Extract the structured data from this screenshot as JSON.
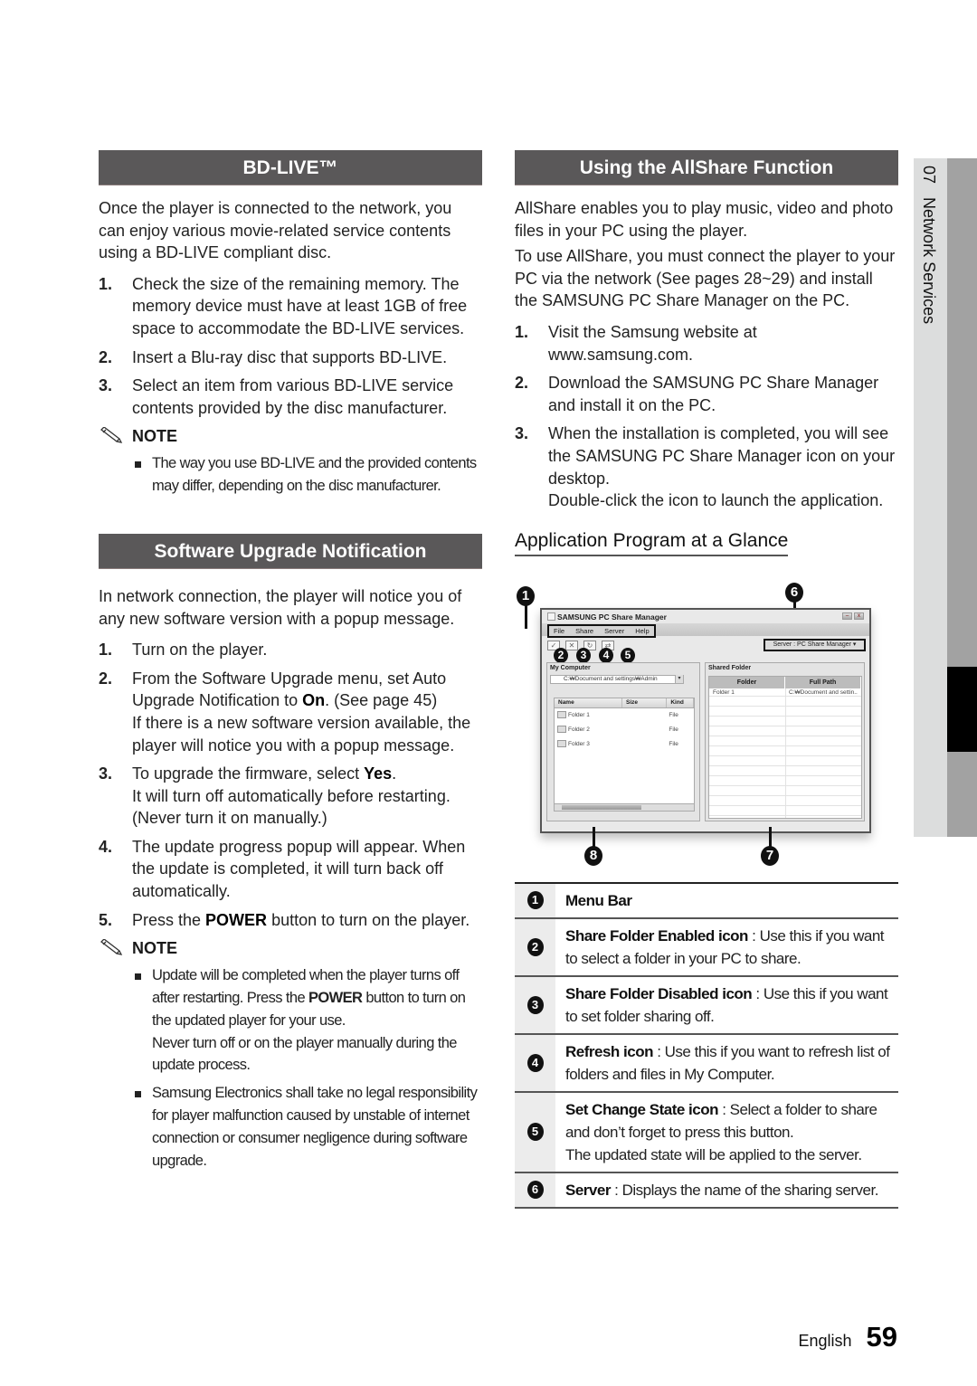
{
  "left": {
    "bdlive": {
      "heading": "BD-LIVE™",
      "intro": "Once the player is connected to the network, you can enjoy various movie-related service contents using a BD-LIVE compliant disc.",
      "steps": [
        {
          "num": "1.",
          "text": "Check the size of the remaining memory. The memory device must have at least 1GB of free space to accommodate the BD-LIVE services."
        },
        {
          "num": "2.",
          "text": "Insert a Blu-ray disc that supports BD-LIVE."
        },
        {
          "num": "3.",
          "text": "Select an item from various BD-LIVE service contents provided by the disc manufacturer."
        }
      ],
      "note_label": "NOTE",
      "notes": [
        "The way you use BD-LIVE and the provided contents may differ, depending on the disc manufacturer."
      ]
    },
    "upgrade": {
      "heading": "Software Upgrade Notification",
      "intro": "In network connection, the player will notice you of any new software version with a popup message.",
      "steps": [
        {
          "num": "1.",
          "pre": "Turn on the player.",
          "bold": "",
          "post": "",
          "extra": ""
        },
        {
          "num": "2.",
          "pre": "From the Software Upgrade menu, set Auto Upgrade Notification to ",
          "bold": "On",
          "post": ". (See page 45)",
          "extra": "If there is a new software version available, the player will notice you with a popup message."
        },
        {
          "num": "3.",
          "pre": "To upgrade the firmware, select ",
          "bold": "Yes",
          "post": ".",
          "extra": "It will turn off automatically before restarting. (Never turn it on manually.)"
        },
        {
          "num": "4.",
          "pre": "The update progress popup will appear. When the update is completed, it will turn back off automatically.",
          "bold": "",
          "post": "",
          "extra": ""
        },
        {
          "num": "5.",
          "pre": "Press the ",
          "bold": "POWER",
          "post": " button to turn on the player.",
          "extra": ""
        }
      ],
      "note_label": "NOTE",
      "notes": [
        {
          "pre": "Update will be completed when the player turns off after restarting. Press the ",
          "bold": "POWER",
          "post": " button to turn on the updated player for your use.",
          "extra": "Never turn off or on the player manually during the update process."
        },
        {
          "pre": "Samsung Electronics shall take no legal responsibility for player malfunction caused by unstable of internet connection or consumer negligence during software upgrade.",
          "bold": "",
          "post": "",
          "extra": ""
        }
      ]
    }
  },
  "right": {
    "allshare": {
      "heading": "Using the AllShare Function",
      "paras": [
        "AllShare enables you to play music, video and photo files in your PC using the player.",
        "To use AllShare, you must connect the player to your PC via the network (See pages 28~29) and install the SAMSUNG PC Share Manager on the PC."
      ],
      "steps": [
        {
          "num": "1.",
          "text": "Visit the Samsung website at www.samsung.com.",
          "extra": ""
        },
        {
          "num": "2.",
          "text": "Download the SAMSUNG PC Share Manager and install it on the PC.",
          "extra": ""
        },
        {
          "num": "3.",
          "text": "When the installation is completed, you will see the SAMSUNG PC Share Manager icon on your desktop.",
          "extra": "Double-click the icon to launch the application."
        }
      ]
    },
    "glance": {
      "heading": "Application Program at a Glance",
      "app": {
        "title": "SAMSUNG PC Share Manager",
        "menu": [
          "File",
          "Share",
          "Server",
          "Help"
        ],
        "server": "Server : PC Share Manager",
        "my_computer": "My Computer",
        "path": "C:₩Document and settings₩Admin",
        "columns": [
          "Name",
          "Size",
          "Kind"
        ],
        "files": [
          {
            "name": "Folder 1",
            "kind": "File"
          },
          {
            "name": "Folder 2",
            "kind": "File"
          },
          {
            "name": "Folder 3",
            "kind": "File"
          }
        ],
        "shared_title": "Shared Folder",
        "shared_columns": [
          "Folder",
          "Full Path"
        ],
        "shared_rows": [
          {
            "folder": "Folder 1",
            "path": "C:₩Document and settin.."
          }
        ]
      },
      "callouts": [
        "1",
        "2",
        "3",
        "4",
        "5",
        "6",
        "7",
        "8"
      ],
      "legend": [
        {
          "num": "1",
          "bold": "Menu Bar",
          "text": ""
        },
        {
          "num": "2",
          "bold": "Share Folder Enabled icon",
          "text": " : Use this if you want to select a folder in your PC to share."
        },
        {
          "num": "3",
          "bold": "Share Folder Disabled icon",
          "text": " : Use this if you want to set folder sharing off."
        },
        {
          "num": "4",
          "bold": "Refresh icon",
          "text": " : Use this if you want to refresh list of folders and files in My Computer."
        },
        {
          "num": "5",
          "bold": "Set Change State icon",
          "text": " : Select a folder to share and don’t forget to press this button.",
          "extra": "The updated state will be applied to the server."
        },
        {
          "num": "6",
          "bold": "Server",
          "text": " : Displays the name of the sharing server."
        }
      ]
    }
  },
  "sidetab": {
    "chapter": "07",
    "title": "Network Services"
  },
  "footer": {
    "language": "English",
    "page": "59"
  }
}
